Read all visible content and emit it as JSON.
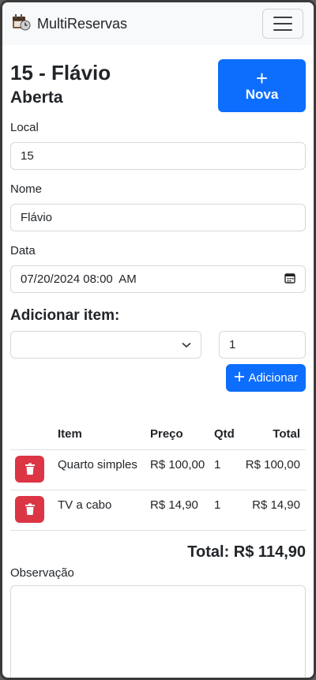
{
  "navbar": {
    "brand": "MultiReservas",
    "brand_icon": "calendar-clock-icon",
    "menu_icon": "hamburger-icon"
  },
  "header": {
    "title": "15 - Flávio",
    "status": "Aberta",
    "new_button_symbol": "+",
    "new_button_label": "Nova"
  },
  "form": {
    "local_label": "Local",
    "local_value": "15",
    "name_label": "Nome",
    "name_value": "Flávio",
    "date_label": "Data",
    "date_value": "07/20/2024 08:00  AM"
  },
  "add_item": {
    "heading": "Adicionar item:",
    "selected_item": "",
    "quantity": "1",
    "button_label": "Adicionar"
  },
  "table": {
    "headers": [
      "",
      "Item",
      "Preço",
      "Qtd",
      "Total"
    ],
    "rows": [
      {
        "item": "Quarto simples",
        "price": "R$ 100,00",
        "qty": "1",
        "total": "R$ 100,00"
      },
      {
        "item": "TV a cabo",
        "price": "R$ 14,90",
        "qty": "1",
        "total": "R$ 14,90"
      }
    ]
  },
  "total_text": "Total: R$ 114,90",
  "observation_label": "Observação",
  "observation_value": "",
  "colors": {
    "primary": "#0d6efd",
    "danger": "#dc3545",
    "navbar_bg": "#f8f9fa"
  }
}
